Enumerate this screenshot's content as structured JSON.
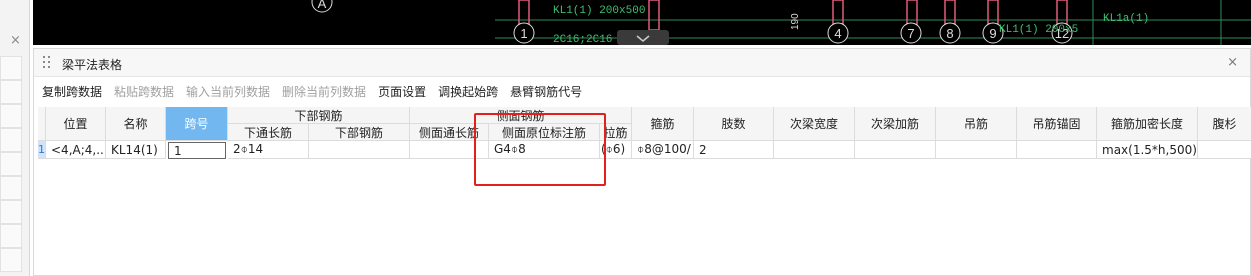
{
  "left_pane": {
    "close_glyph": "×"
  },
  "cad": {
    "axis_labels": [
      "A",
      "1",
      "4",
      "7",
      "8",
      "9",
      "12"
    ],
    "beam_labels": [
      "KL1(1) 200x500",
      "2C16;2C16",
      "KL1(1) 200x5",
      "KL1a(1)"
    ],
    "dim_text": "190"
  },
  "panel": {
    "title": "梁平法表格",
    "close_glyph": "×"
  },
  "toolbar": [
    {
      "label": "复制跨数据",
      "enabled": true
    },
    {
      "label": "粘贴跨数据",
      "enabled": false
    },
    {
      "label": "输入当前列数据",
      "enabled": false
    },
    {
      "label": "删除当前列数据",
      "enabled": false
    },
    {
      "label": "页面设置",
      "enabled": true
    },
    {
      "label": "调换起始跨",
      "enabled": true
    },
    {
      "label": "悬臂钢筋代号",
      "enabled": true
    }
  ],
  "table": {
    "group_headers": {
      "bottom_rebar": "下部钢筋",
      "side_rebar": "侧面钢筋"
    },
    "headers": {
      "position": "位置",
      "name": "名称",
      "span_no": "跨号",
      "bottom_through": "下通长筋",
      "bottom_rebar": "下部钢筋",
      "side_through": "侧面通长筋",
      "side_in_situ": "侧面原位标注筋",
      "tie_bar": "拉筋",
      "stirrup": "箍筋",
      "legs": "肢数",
      "secondary_width": "次梁宽度",
      "secondary_added": "次梁加筋",
      "hanger": "吊筋",
      "hanger_anchor": "吊筋锚固",
      "stirrup_dense_len": "箍筋加密长度",
      "legs2": "腹杉"
    },
    "rows": [
      {
        "row_no": "1",
        "position": "<4,A;4,...",
        "name": "KL14(1)",
        "span_no": "1",
        "bottom_through": "2⌽14",
        "bottom_rebar": "",
        "side_through": "",
        "side_in_situ": "G4⌽8",
        "tie_bar": "(⌽6)",
        "stirrup": "⌽8@100/",
        "legs": "2",
        "secondary_width": "",
        "secondary_added": "",
        "hanger": "",
        "hanger_anchor": "",
        "stirrup_dense_len": "max(1.5*h,500)",
        "legs2": ""
      }
    ]
  },
  "highlight": {
    "color": "#e0221b"
  }
}
